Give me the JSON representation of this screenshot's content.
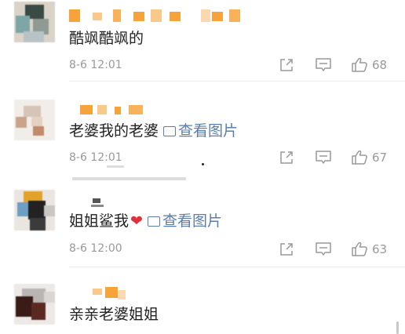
{
  "comments": [
    {
      "text": "酷飒酷飒的",
      "time": "8-6 12:01",
      "likes": "68",
      "has_image_link": false,
      "has_heart": false
    },
    {
      "text": "老婆我的老婆",
      "time": "8-6 12:01",
      "likes": "67",
      "has_image_link": true,
      "has_heart": false
    },
    {
      "text": "姐姐鲨我",
      "time": "8-6 12:00",
      "likes": "63",
      "has_image_link": true,
      "has_heart": true
    },
    {
      "text": "亲亲老婆姐姐",
      "time": "",
      "likes": "",
      "has_image_link": false,
      "has_heart": false
    }
  ],
  "labels": {
    "view_image": "查看图片",
    "heart": "❤"
  },
  "icons": {
    "repost": "repost-icon",
    "comment": "comment-icon",
    "like": "thumbs-up-icon",
    "image": "image-icon"
  },
  "colors": {
    "text": "#222222",
    "meta": "#999999",
    "link": "#5b7eab",
    "heart": "#e0303a",
    "username_redaction": "#f6a33c"
  }
}
